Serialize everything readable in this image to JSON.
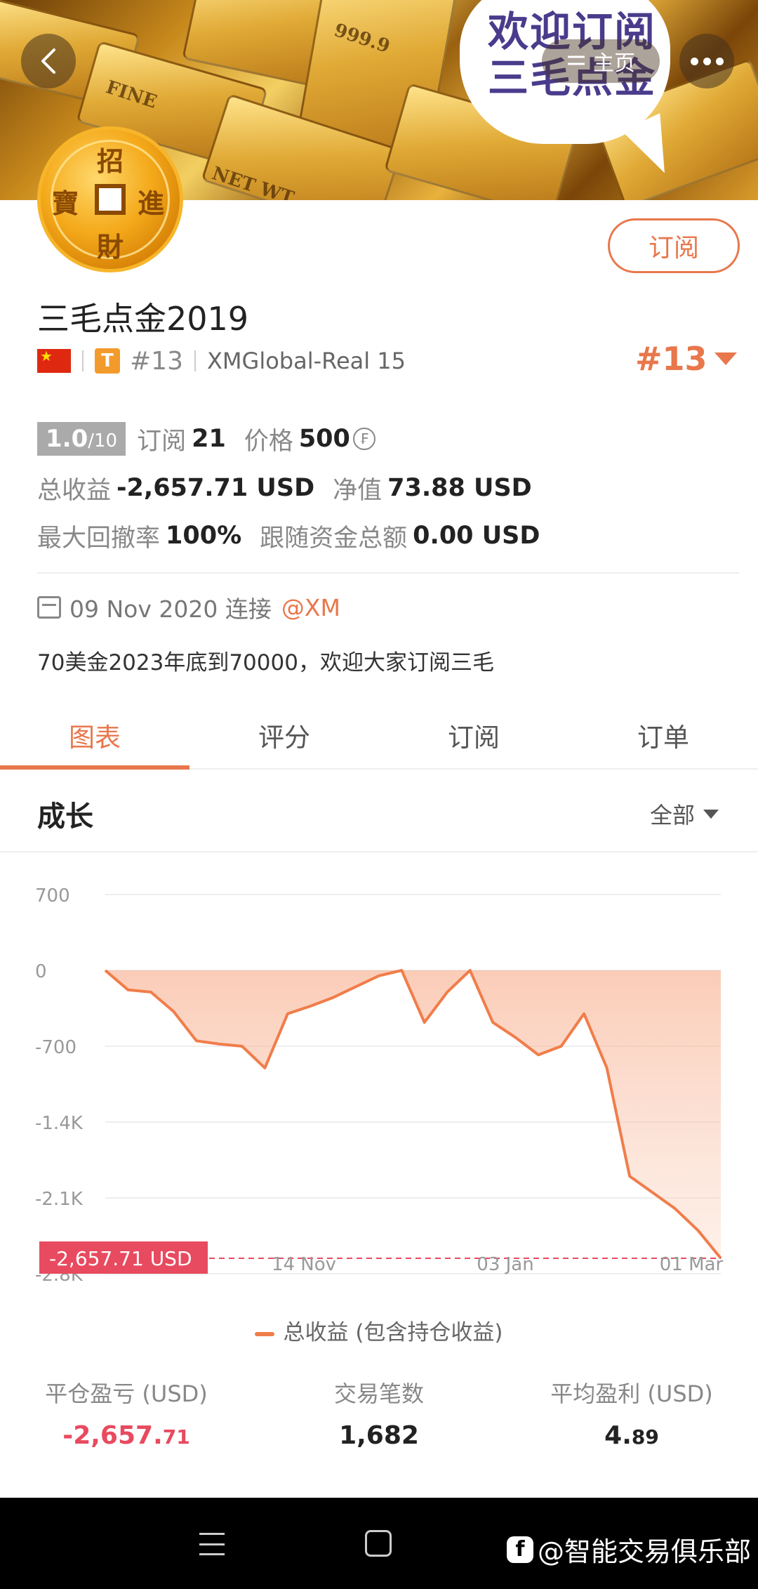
{
  "header": {
    "banner_bubble_line1": "欢迎订阅",
    "banner_bubble_line2": "三毛点金",
    "home_label": "主页",
    "coin_chars": [
      "招",
      "進",
      "財",
      "寶"
    ]
  },
  "profile": {
    "subscribe_label": "订阅",
    "account_name": "三毛点金2019",
    "badge_letter": "T",
    "rank_small": "#13",
    "broker": "XMGlobal-Real 15",
    "rank_big": "#13"
  },
  "stats": {
    "score_main": "1.0",
    "score_sub": "/10",
    "subscribe_label": "订阅",
    "subscribe_count": "21",
    "price_label": "价格",
    "price_value": "500",
    "total_profit_label": "总收益",
    "total_profit_value": "-2,657.71 USD",
    "net_value_label": "净值",
    "net_value_value": "73.88 USD",
    "max_drawdown_label": "最大回撤率",
    "max_drawdown_value": "100%",
    "follow_total_label": "跟随资金总额",
    "follow_total_value": "0.00 USD"
  },
  "info": {
    "date_text": "09 Nov 2020 连接",
    "broker_link": "@XM",
    "description": "70美金2023年底到70000，欢迎大家订阅三毛"
  },
  "tabs": [
    {
      "label": "图表",
      "active": true
    },
    {
      "label": "评分",
      "active": false
    },
    {
      "label": "订阅",
      "active": false
    },
    {
      "label": "订单",
      "active": false
    }
  ],
  "section": {
    "title": "成长",
    "range_label": "全部"
  },
  "chart_data": {
    "type": "area",
    "y_ticks": [
      "700",
      "0",
      "-700",
      "-1.4K",
      "-2.1K",
      "-2.8K"
    ],
    "ylim": [
      -2800,
      700
    ],
    "x_ticks": [
      "14 Nov",
      "03 Jan",
      "01 Mar"
    ],
    "current_label": "-2,657.71 USD",
    "current_value": -2657.71,
    "series": [
      {
        "name": "总收益 (包含持仓收益)",
        "values": [
          0,
          -180,
          -200,
          -380,
          -650,
          -680,
          -700,
          -900,
          -400,
          -330,
          -250,
          -150,
          -50,
          0,
          -480,
          -200,
          0,
          -480,
          -620,
          -780,
          -700,
          -400,
          -900,
          -1900,
          -2050,
          -2200,
          -2400,
          -2657.71
        ]
      }
    ],
    "color": "#f07d4a"
  },
  "legend": {
    "label": "总收益 (包含持仓收益)"
  },
  "summary": [
    {
      "label": "平仓盈亏 (USD)",
      "value_main": "-2,657.",
      "value_dec": "71",
      "negative": true
    },
    {
      "label": "交易笔数",
      "value_main": "1,682",
      "value_dec": "",
      "negative": false
    },
    {
      "label": "平均盈利 (USD)",
      "value_main": "4.",
      "value_dec": "89",
      "negative": false
    }
  ],
  "footer": {
    "watermark": "@智能交易俱乐部"
  }
}
